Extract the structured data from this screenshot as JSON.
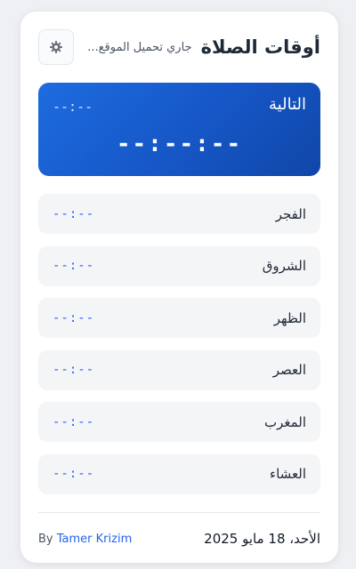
{
  "header": {
    "title": "أوقات الصلاة",
    "status": "جاري تحميل الموقع..."
  },
  "next_prayer": {
    "label": "التالية",
    "time": "--:--",
    "countdown": "--:--:--"
  },
  "prayers": [
    {
      "name": "الفجر",
      "time": "--:--"
    },
    {
      "name": "الشروق",
      "time": "--:--"
    },
    {
      "name": "الظهر",
      "time": "--:--"
    },
    {
      "name": "العصر",
      "time": "--:--"
    },
    {
      "name": "المغرب",
      "time": "--:--"
    },
    {
      "name": "العشاء",
      "time": "--:--"
    }
  ],
  "footer": {
    "by": "By",
    "author": "Tamer Krizim",
    "date": "الأحد، 18 مايو 2025"
  },
  "colors": {
    "accent": "#2563eb",
    "card_gradient_start": "#1d6ce0",
    "card_gradient_end": "#1047a8"
  },
  "icons": {
    "settings": "gear-icon"
  }
}
